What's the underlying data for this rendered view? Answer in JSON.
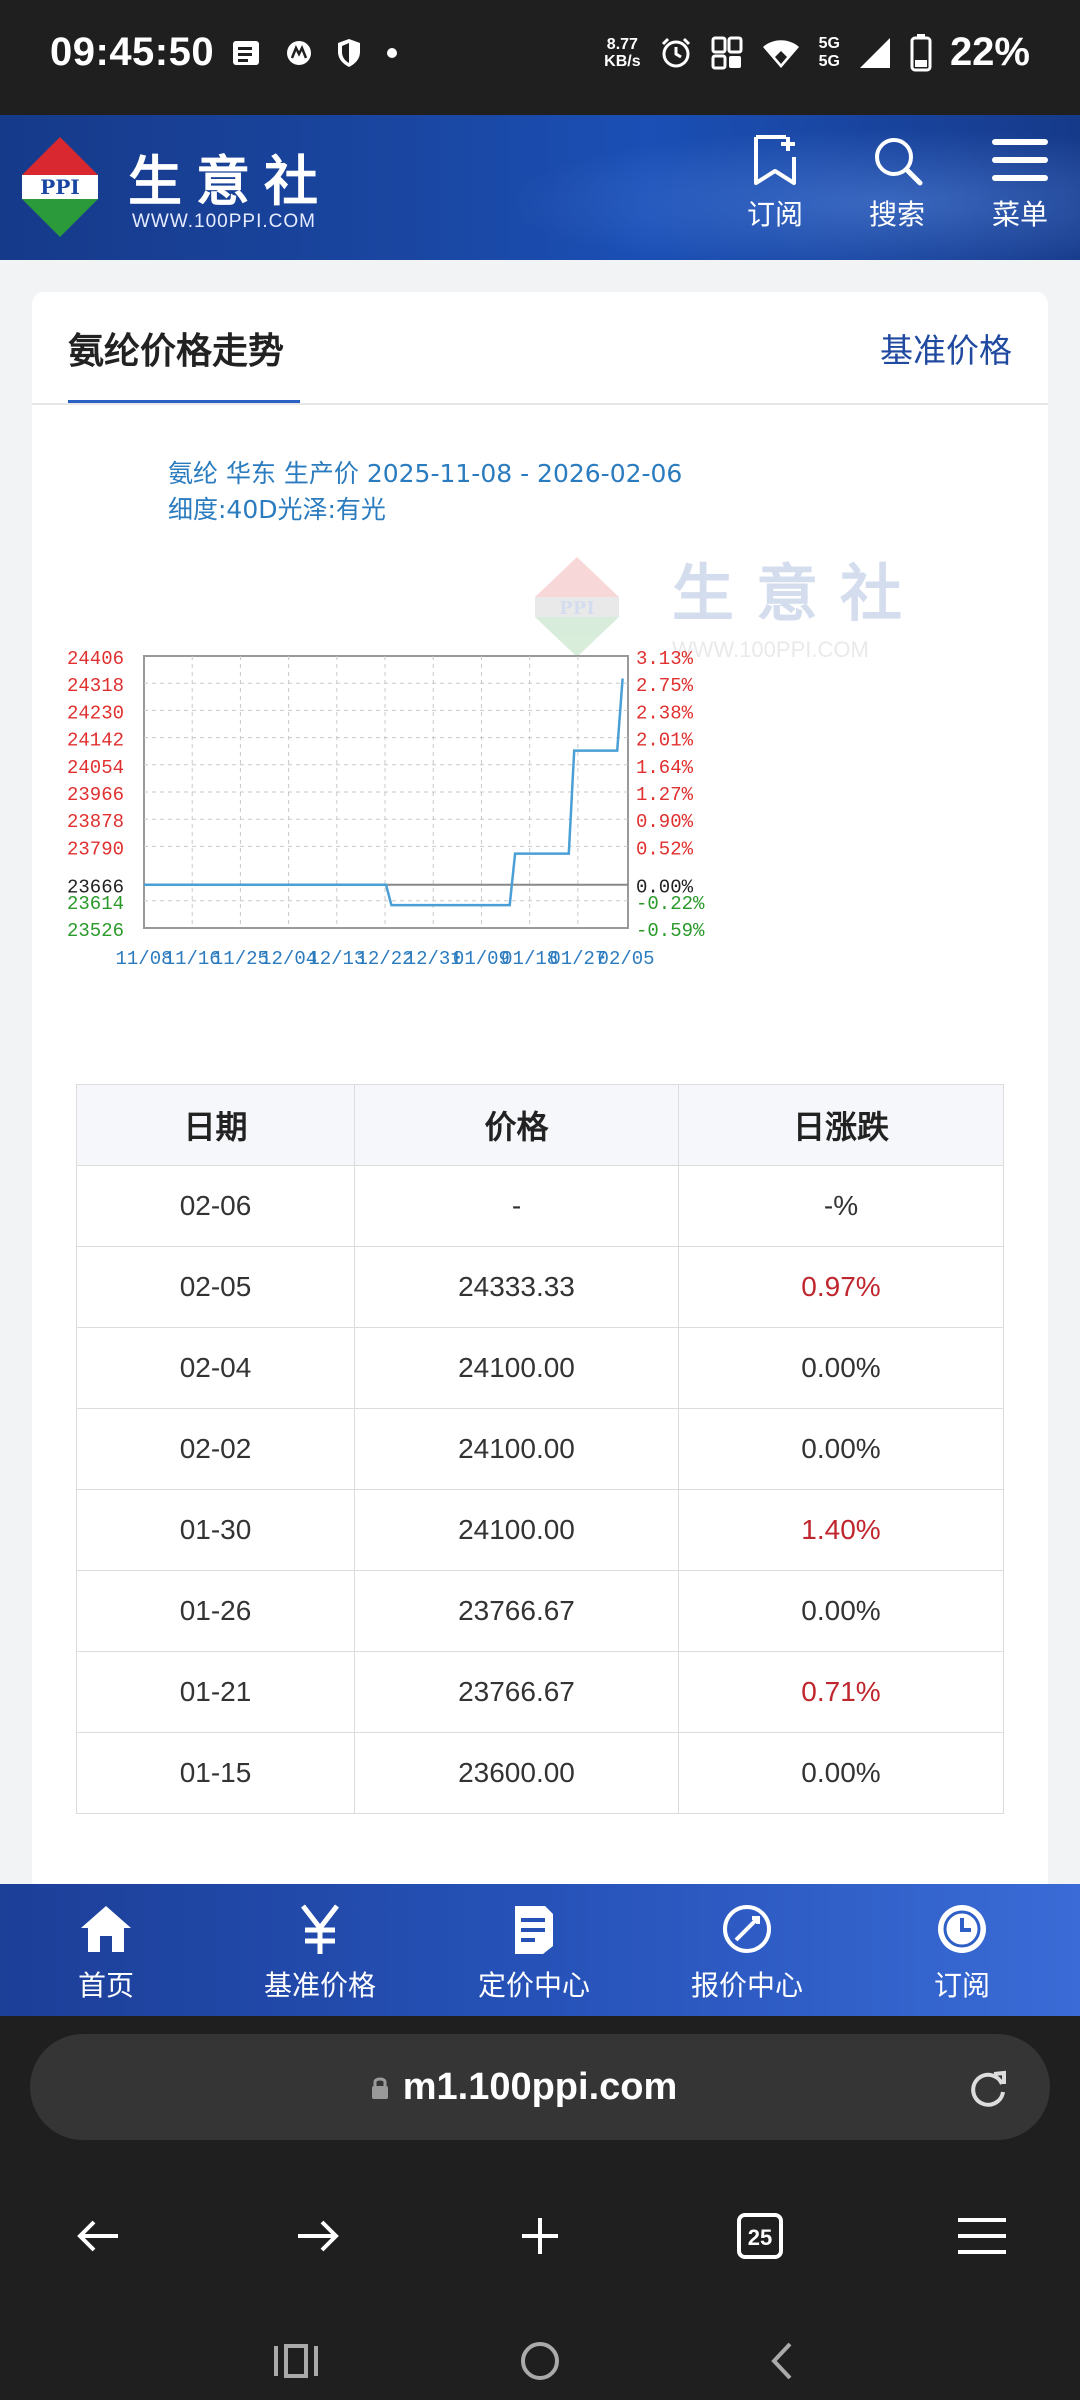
{
  "status_bar": {
    "time": "09:45:50",
    "net_speed_value": "8.77",
    "net_speed_unit": "KB/s",
    "signal_label_1": "5G",
    "signal_label_2": "5G",
    "battery": "22%"
  },
  "header": {
    "logo_text": "PPI",
    "brand_name": "生意社",
    "brand_url": "WWW.100PPI.COM",
    "subscribe_label": "订阅",
    "search_label": "搜索",
    "menu_label": "菜单"
  },
  "card": {
    "title": "氨纶价格走势",
    "link": "基准价格"
  },
  "chart_data": {
    "type": "line",
    "title": "氨纶 华东 生产价 2025-11-08 - 2026-02-06",
    "subtitle": "细度:40D光泽:有光",
    "watermark_brand": "生意社",
    "watermark_url": "WWW.100PPI.COM",
    "watermark_logo": "PPI",
    "xlabel": "",
    "ylabel": "",
    "x_tick_labels": [
      "11/08",
      "11/16",
      "11/25",
      "12/04",
      "12/13",
      "12/22",
      "12/31",
      "01/09",
      "01/18",
      "01/27",
      "02/05"
    ],
    "y_tick_labels": [
      "24406",
      "24318",
      "24230",
      "24142",
      "24054",
      "23966",
      "23878",
      "23790",
      "23666",
      "23614",
      "23526"
    ],
    "y2_tick_labels": [
      "3.13%",
      "2.75%",
      "2.38%",
      "2.01%",
      "1.64%",
      "1.27%",
      "0.90%",
      "0.52%",
      "0.00%",
      "-0.22%",
      "-0.59%"
    ],
    "ylim": [
      23526,
      24406
    ],
    "y2lim": [
      "-0.59%",
      "3.13%"
    ],
    "baseline": 23666,
    "x_range": [
      "2025-11-08",
      "2026-02-06"
    ],
    "grid": true,
    "series": [
      {
        "color": "#4a9fd6",
        "points": [
          [
            "2025-11-08",
            23666
          ],
          [
            "2025-12-23",
            23666
          ],
          [
            "2025-12-24",
            23600
          ],
          [
            "2026-01-14",
            23600
          ],
          [
            "2026-01-15",
            23600
          ],
          [
            "2026-01-16",
            23766.67
          ],
          [
            "2026-01-26",
            23766.67
          ],
          [
            "2026-01-27",
            24100
          ],
          [
            "2026-02-04",
            24100
          ],
          [
            "2026-02-05",
            24333.33
          ]
        ]
      }
    ]
  },
  "table": {
    "headers": [
      "日期",
      "价格",
      "日涨跌"
    ],
    "rows": [
      {
        "date": "02-06",
        "price": "-",
        "change": "-%",
        "up": false
      },
      {
        "date": "02-05",
        "price": "24333.33",
        "change": "0.97%",
        "up": true
      },
      {
        "date": "02-04",
        "price": "24100.00",
        "change": "0.00%",
        "up": false
      },
      {
        "date": "02-02",
        "price": "24100.00",
        "change": "0.00%",
        "up": false
      },
      {
        "date": "01-30",
        "price": "24100.00",
        "change": "1.40%",
        "up": true
      },
      {
        "date": "01-26",
        "price": "23766.67",
        "change": "0.00%",
        "up": false
      },
      {
        "date": "01-21",
        "price": "23766.67",
        "change": "0.71%",
        "up": true
      },
      {
        "date": "01-15",
        "price": "23600.00",
        "change": "0.00%",
        "up": false
      }
    ]
  },
  "bottom_nav": {
    "home": "首页",
    "benchmark": "基准价格",
    "pricing": "定价中心",
    "quotes": "报价中心",
    "subscribe": "订阅"
  },
  "browser": {
    "url": "m1.100ppi.com",
    "tab_count": "25"
  },
  "colors": {
    "header_blue": "#1a47a3",
    "link_blue": "#1f4aa0",
    "up_red": "#c0262d",
    "down_green": "#2a9a2a",
    "line_blue": "#4a9fd6"
  }
}
